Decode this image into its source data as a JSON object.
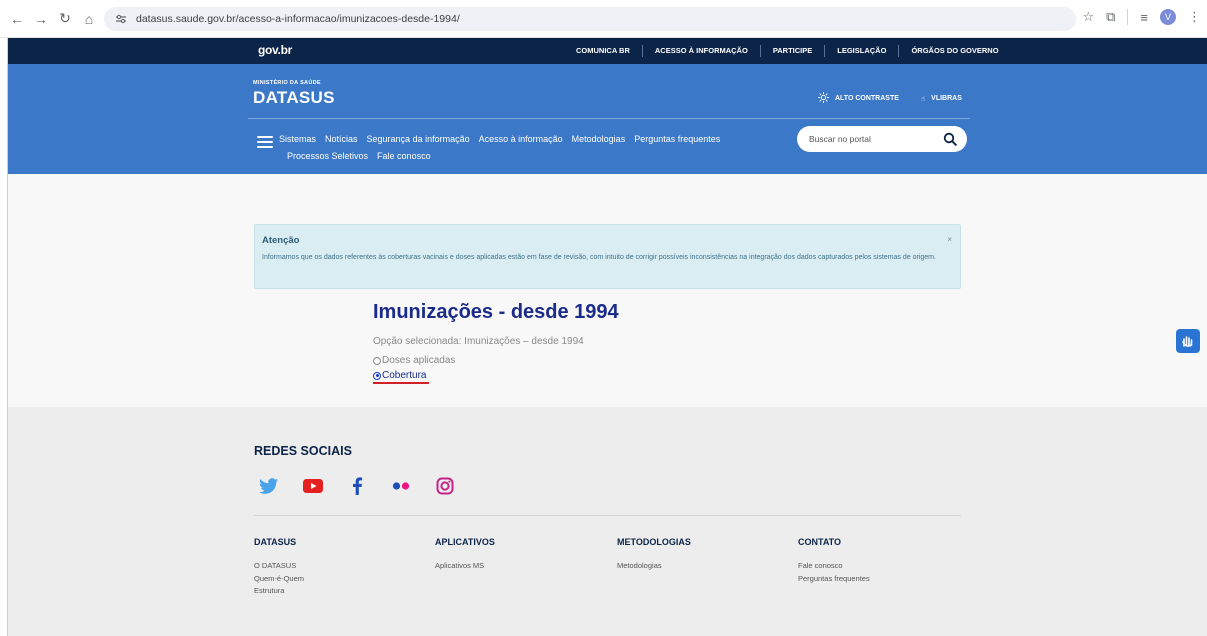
{
  "browser": {
    "url": "datasus.saude.gov.br/acesso-a-informacao/imunizacoes-desde-1994/",
    "profile_initial": "V"
  },
  "govbar": {
    "logo": "gov.br",
    "links": [
      "COMUNICA BR",
      "ACESSO À INFORMAÇÃO",
      "PARTICIPE",
      "LEGISLAÇÃO",
      "ÓRGÃOS DO GOVERNO"
    ]
  },
  "header": {
    "ministry": "MINISTÉRIO DA SAÚDE",
    "brand": "DATASUS",
    "contrast": "ALTO CONTRASTE",
    "vlibras": "VLIBRAS",
    "search_placeholder": "Buscar no portal",
    "nav_row1": [
      "Sistemas",
      "Notícias",
      "Segurança da informação",
      "Acesso à informação",
      "Metodologias",
      "Perguntas frequentes"
    ],
    "nav_row2": [
      "Processos Seletivos",
      "Fale conosco"
    ]
  },
  "alert": {
    "title": "Atenção",
    "text": "Informamos que os dados referentes às coberturas vacinais e doses aplicadas estão em fase de revisão, com intuito de corrigir possíveis inconsistências na integração dos dados capturados pelos sistemas de origem.",
    "close": "×"
  },
  "main": {
    "title": "Imunizações - desde 1994",
    "selected": "Opção selecionada: Imunizações – desde 1994",
    "options": [
      {
        "label": "Doses aplicadas",
        "checked": false
      },
      {
        "label": "Cobertura",
        "checked": true
      }
    ]
  },
  "footer": {
    "social_title": "REDES SOCIAIS",
    "social_icons": [
      "twitter-icon",
      "youtube-icon",
      "facebook-icon",
      "flickr-icon",
      "instagram-icon"
    ],
    "columns": [
      {
        "heading": "DATASUS",
        "links": [
          "O DATASUS",
          "Quem-é-Quem",
          "Estrutura"
        ]
      },
      {
        "heading": "APLICATIVOS",
        "links": [
          "Aplicativos MS"
        ]
      },
      {
        "heading": "METODOLOGIAS",
        "links": [
          "Metodologias"
        ]
      },
      {
        "heading": "CONTATO",
        "links": [
          "Fale conosco",
          "Perguntas frequentes"
        ]
      }
    ]
  },
  "colors": {
    "govbar": "#0c2447",
    "header": "#3b78c8",
    "title": "#1a2b89",
    "alert_bg": "#d9edf3"
  }
}
